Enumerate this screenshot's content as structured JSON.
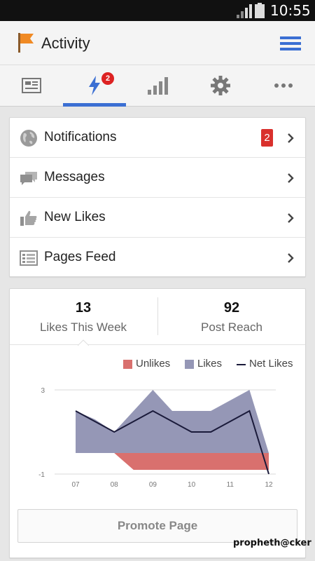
{
  "status_bar": {
    "time": "10:55"
  },
  "app_bar": {
    "title": "Activity"
  },
  "tabs": [
    {
      "name": "news-feed",
      "active": false
    },
    {
      "name": "activity",
      "active": true,
      "badge": "2"
    },
    {
      "name": "insights",
      "active": false
    },
    {
      "name": "settings",
      "active": false
    },
    {
      "name": "more",
      "active": false
    }
  ],
  "list": [
    {
      "label": "Notifications",
      "icon": "globe-icon",
      "badge": "2"
    },
    {
      "label": "Messages",
      "icon": "messages-icon"
    },
    {
      "label": "New Likes",
      "icon": "thumbs-up-icon"
    },
    {
      "label": "Pages Feed",
      "icon": "feed-icon"
    }
  ],
  "stats": [
    {
      "value": "13",
      "label": "Likes This Week"
    },
    {
      "value": "92",
      "label": "Post Reach"
    }
  ],
  "chart_data": {
    "type": "area",
    "title": "",
    "xlabel": "",
    "ylabel": "",
    "categories": [
      "07",
      "08",
      "09",
      "10",
      "11",
      "12"
    ],
    "x": [
      7,
      7.5,
      8,
      8.5,
      9,
      9.5,
      10,
      10.5,
      11,
      11.5,
      12
    ],
    "ylim": [
      -1,
      3
    ],
    "yticks": [
      "3",
      "-1"
    ],
    "grid": true,
    "legend_position": "top-right",
    "series": [
      {
        "name": "Unlikes",
        "color": "#d9706e",
        "values": [
          0,
          0,
          0,
          -0.8,
          -0.8,
          -0.8,
          -0.8,
          -0.8,
          -0.8,
          -0.8,
          -0.8
        ]
      },
      {
        "name": "Likes",
        "color": "#9597b6",
        "values": [
          2,
          1.6,
          1,
          2,
          3,
          2,
          2,
          2,
          2.5,
          3,
          0
        ]
      },
      {
        "name": "Net Likes",
        "color": "#1a1a3a",
        "values": [
          2,
          1.5,
          1,
          1.5,
          2,
          1.5,
          1,
          1,
          1.5,
          2,
          -1
        ]
      }
    ]
  },
  "actions": {
    "promote_label": "Promote Page"
  },
  "watermark": "propheth@cker",
  "colors": {
    "accent": "#3b6fd3",
    "badge": "#d9302c",
    "flag": "#f08a24",
    "menu": "#3b6fd3"
  }
}
